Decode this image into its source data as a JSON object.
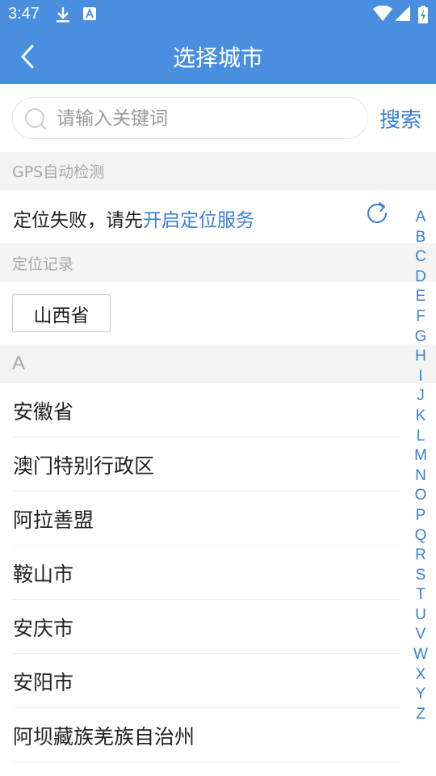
{
  "status_bar": {
    "time": "3:47",
    "left_icons": [
      "download-icon",
      "font-app-icon"
    ],
    "right_icons": [
      "wifi-icon",
      "signal-icon",
      "battery-charging-icon"
    ]
  },
  "app_bar": {
    "title": "选择城市",
    "back_icon": "chevron-left-icon",
    "background_color": "#4a8ee0"
  },
  "search": {
    "placeholder": "请输入关键词",
    "value": "",
    "button_label": "搜索"
  },
  "gps": {
    "section_title": "GPS自动检测",
    "status_text": "定位失败，请先",
    "link_text": "开启定位服务",
    "refresh_icon": "refresh-icon"
  },
  "history": {
    "section_title": "定位记录",
    "items": [
      "山西省"
    ]
  },
  "city_groups": [
    {
      "letter": "A",
      "cities": [
        "安徽省",
        "澳门特别行政区",
        "阿拉善盟",
        "鞍山市",
        "安庆市",
        "安阳市",
        "阿坝藏族羌族自治州"
      ]
    }
  ],
  "index_letters": [
    "A",
    "B",
    "C",
    "D",
    "E",
    "F",
    "G",
    "H",
    "I",
    "J",
    "K",
    "L",
    "M",
    "N",
    "O",
    "P",
    "Q",
    "R",
    "S",
    "T",
    "U",
    "V",
    "W",
    "X",
    "Y",
    "Z"
  ],
  "colors": {
    "accent": "#3a7fd8",
    "header_bg": "#4a8ee0",
    "section_bg": "#f3f3f3"
  }
}
